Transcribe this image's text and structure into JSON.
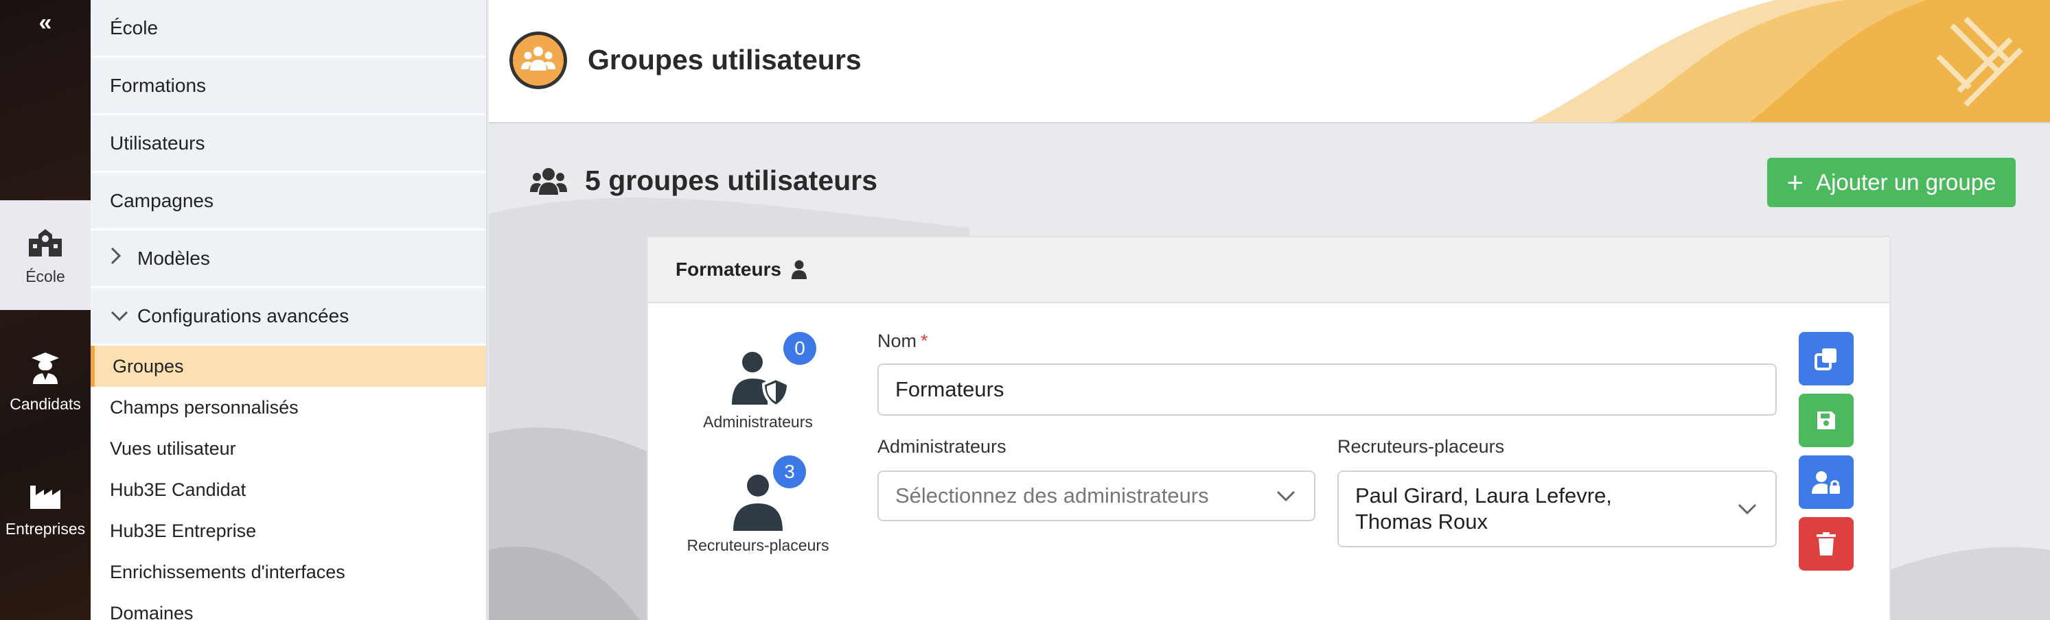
{
  "rail": {
    "collapse_glyph": "«",
    "items": [
      {
        "label": "École",
        "icon": "school-icon"
      },
      {
        "label": "Candidats",
        "icon": "graduate-icon"
      },
      {
        "label": "Entreprises",
        "icon": "factory-icon"
      }
    ]
  },
  "submenu": {
    "blocks": [
      "École",
      "Formations",
      "Utilisateurs",
      "Campagnes",
      "Modèles",
      "Configurations avancées"
    ],
    "items": [
      "Groupes",
      "Champs personnalisés",
      "Vues utilisateur",
      "Hub3E Candidat",
      "Hub3E Entreprise",
      "Enrichissements d'interfaces",
      "Domaines"
    ]
  },
  "header": {
    "title": "Groupes utilisateurs"
  },
  "main": {
    "count_title": "5 groupes utilisateurs",
    "add_button": "Ajouter un groupe"
  },
  "card": {
    "title": "Formateurs",
    "admins_count": "0",
    "admins_label": "Administrateurs",
    "recruiters_count": "3",
    "recruiters_label": "Recruteurs-placeurs",
    "name_label": "Nom",
    "name_required": "*",
    "name_value": "Formateurs",
    "admins_field_label": "Administrateurs",
    "admins_placeholder": "Sélectionnez des administrateurs",
    "recruiters_field_label": "Recruteurs-placeurs",
    "recruiters_line1": "Paul Girard, Laura Lefevre,",
    "recruiters_line2": "Thomas Roux"
  },
  "colors": {
    "accent_orange": "#f0a54a",
    "active_bg": "#fbe1b2",
    "green": "#4cb95e",
    "blue": "#3f7be6",
    "red": "#dc4041"
  }
}
